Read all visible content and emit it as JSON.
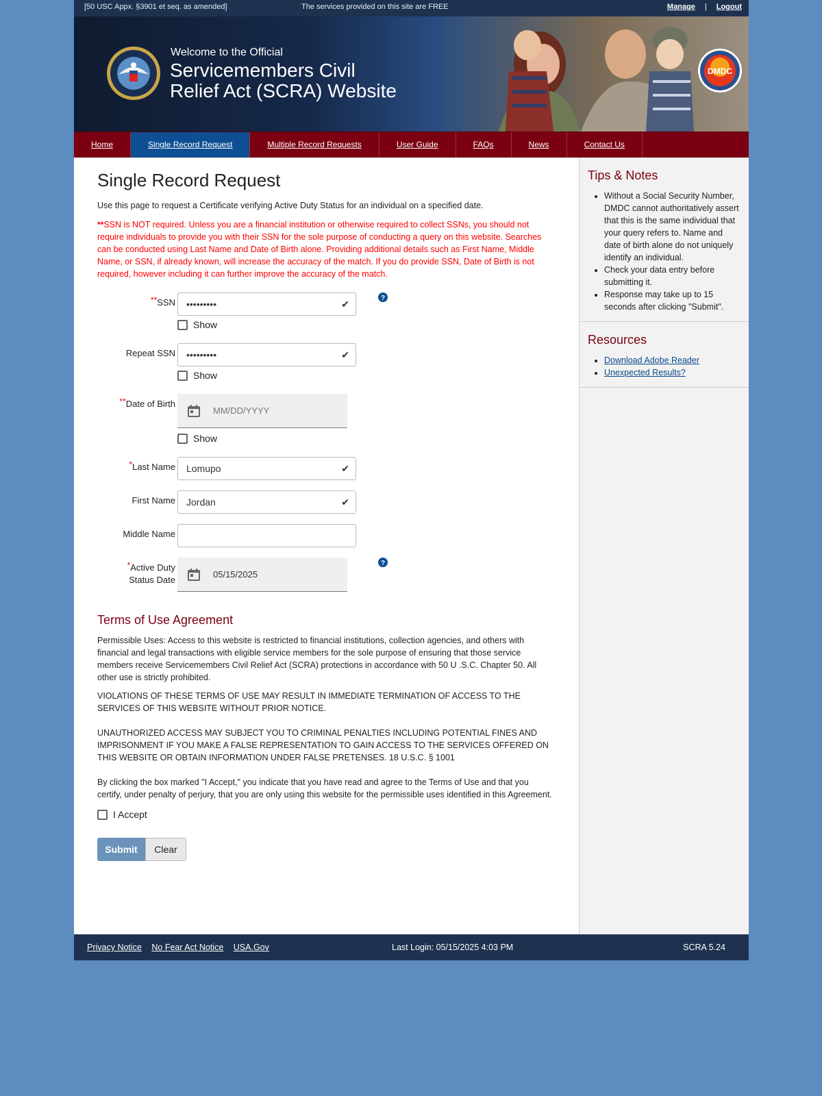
{
  "topbar": {
    "legal": "[50 USC Appx. §3901 et seq. as amended]",
    "notice": "The services provided on this site are FREE",
    "manage": "Manage",
    "separator": "|",
    "logout": "Logout"
  },
  "banner": {
    "welcome": "Welcome to the Official",
    "title_line1": "Servicemembers Civil",
    "title_line2": "Relief Act (SCRA) Website",
    "dmdc_logo": "DMDC"
  },
  "nav": {
    "items": [
      {
        "label": "Home"
      },
      {
        "label": "Single Record Request",
        "active": true
      },
      {
        "label": "Multiple Record Requests"
      },
      {
        "label": "User Guide"
      },
      {
        "label": "FAQs"
      },
      {
        "label": "News"
      },
      {
        "label": "Contact Us"
      }
    ]
  },
  "main": {
    "title": "Single Record Request",
    "intro": "Use this page to request a Certificate verifying Active Duty Status for an individual on a specified date.",
    "warning_marker": "**",
    "warning": "SSN is NOT required. Unless you are a financial institution or otherwise required to collect SSNs, you should not require individuals to provide you with their SSN for the sole purpose of conducting a query on this website. Searches can be conducted using Last Name and Date of Birth alone. Providing additional details such as First Name, Middle Name, or SSN, if already known, will increase the accuracy of the match. If you do provide SSN, Date of Birth is not required, however including it can further improve the accuracy of the match."
  },
  "form": {
    "ssn": {
      "marker": "**",
      "label": "SSN",
      "value": "•••••••••",
      "show_label": "Show"
    },
    "repeat_ssn": {
      "label": "Repeat SSN",
      "value": "•••••••••",
      "show_label": "Show"
    },
    "dob": {
      "marker": "**",
      "label": "Date of Birth",
      "placeholder": "MM/DD/YYYY",
      "show_label": "Show"
    },
    "last_name": {
      "marker": "*",
      "label": "Last Name",
      "value": "Lomupo"
    },
    "first_name": {
      "label": "First Name",
      "value": "Jordan"
    },
    "middle_name": {
      "label": "Middle Name",
      "value": ""
    },
    "active_duty_date": {
      "marker": "*",
      "label_line1": "Active Duty",
      "label_line2": "Status Date",
      "value": "05/15/2025"
    }
  },
  "terms": {
    "title": "Terms of Use Agreement",
    "p1": "Permissible Uses: Access to this website is restricted to financial institutions, collection agencies, and others with financial and legal transactions with eligible service members for the sole purpose of ensuring that those service members receive Servicemembers Civil Relief Act (SCRA) protections in accordance with 50 U .S.C. Chapter 50. All other use is strictly prohibited.",
    "p2": "VIOLATIONS OF THESE TERMS OF USE MAY RESULT IN IMMEDIATE TERMINATION OF ACCESS TO THE SERVICES OF THIS WEBSITE WITHOUT PRIOR NOTICE.",
    "p3": "UNAUTHORIZED ACCESS MAY SUBJECT YOU TO CRIMINAL PENALTIES INCLUDING POTENTIAL FINES AND IMPRISONMENT IF YOU MAKE A FALSE REPRESENTATION TO GAIN ACCESS TO THE SERVICES OFFERED ON THIS WEBSITE OR OBTAIN INFORMATION UNDER FALSE PRETENSES. 18 U.S.C. § 1001",
    "p4": "By clicking the box marked \"I Accept,\" you indicate that you have read and agree to the Terms of Use and that you certify, under penalty of perjury, that you are only using this website for the permissible uses identified in this Agreement.",
    "accept_label": "I Accept"
  },
  "buttons": {
    "submit": "Submit",
    "clear": "Clear"
  },
  "sidebar": {
    "tips_title": "Tips & Notes",
    "tips": [
      "Without a Social Security Number, DMDC cannot authoritatively assert that this is the same individual that your query refers to. Name and date of birth alone do not uniquely identify an individual.",
      "Check your data entry before submitting it.",
      "Response may take up to 15 seconds after clicking \"Submit\"."
    ],
    "resources_title": "Resources",
    "resources": [
      "Download Adobe Reader",
      "Unexpected Results?"
    ]
  },
  "footer": {
    "links": [
      "Privacy Notice",
      "No Fear Act Notice",
      "USA.Gov"
    ],
    "last_login": "Last Login: 05/15/2025 4:03 PM",
    "version": "SCRA 5.24"
  },
  "colors": {
    "nav_bg": "#7a0012",
    "nav_active": "#0d4f92",
    "topbar_bg": "#1e3250",
    "page_bg": "#5d8cbe",
    "warning_text": "#ff0000",
    "submit_bg": "#6b93ba"
  }
}
